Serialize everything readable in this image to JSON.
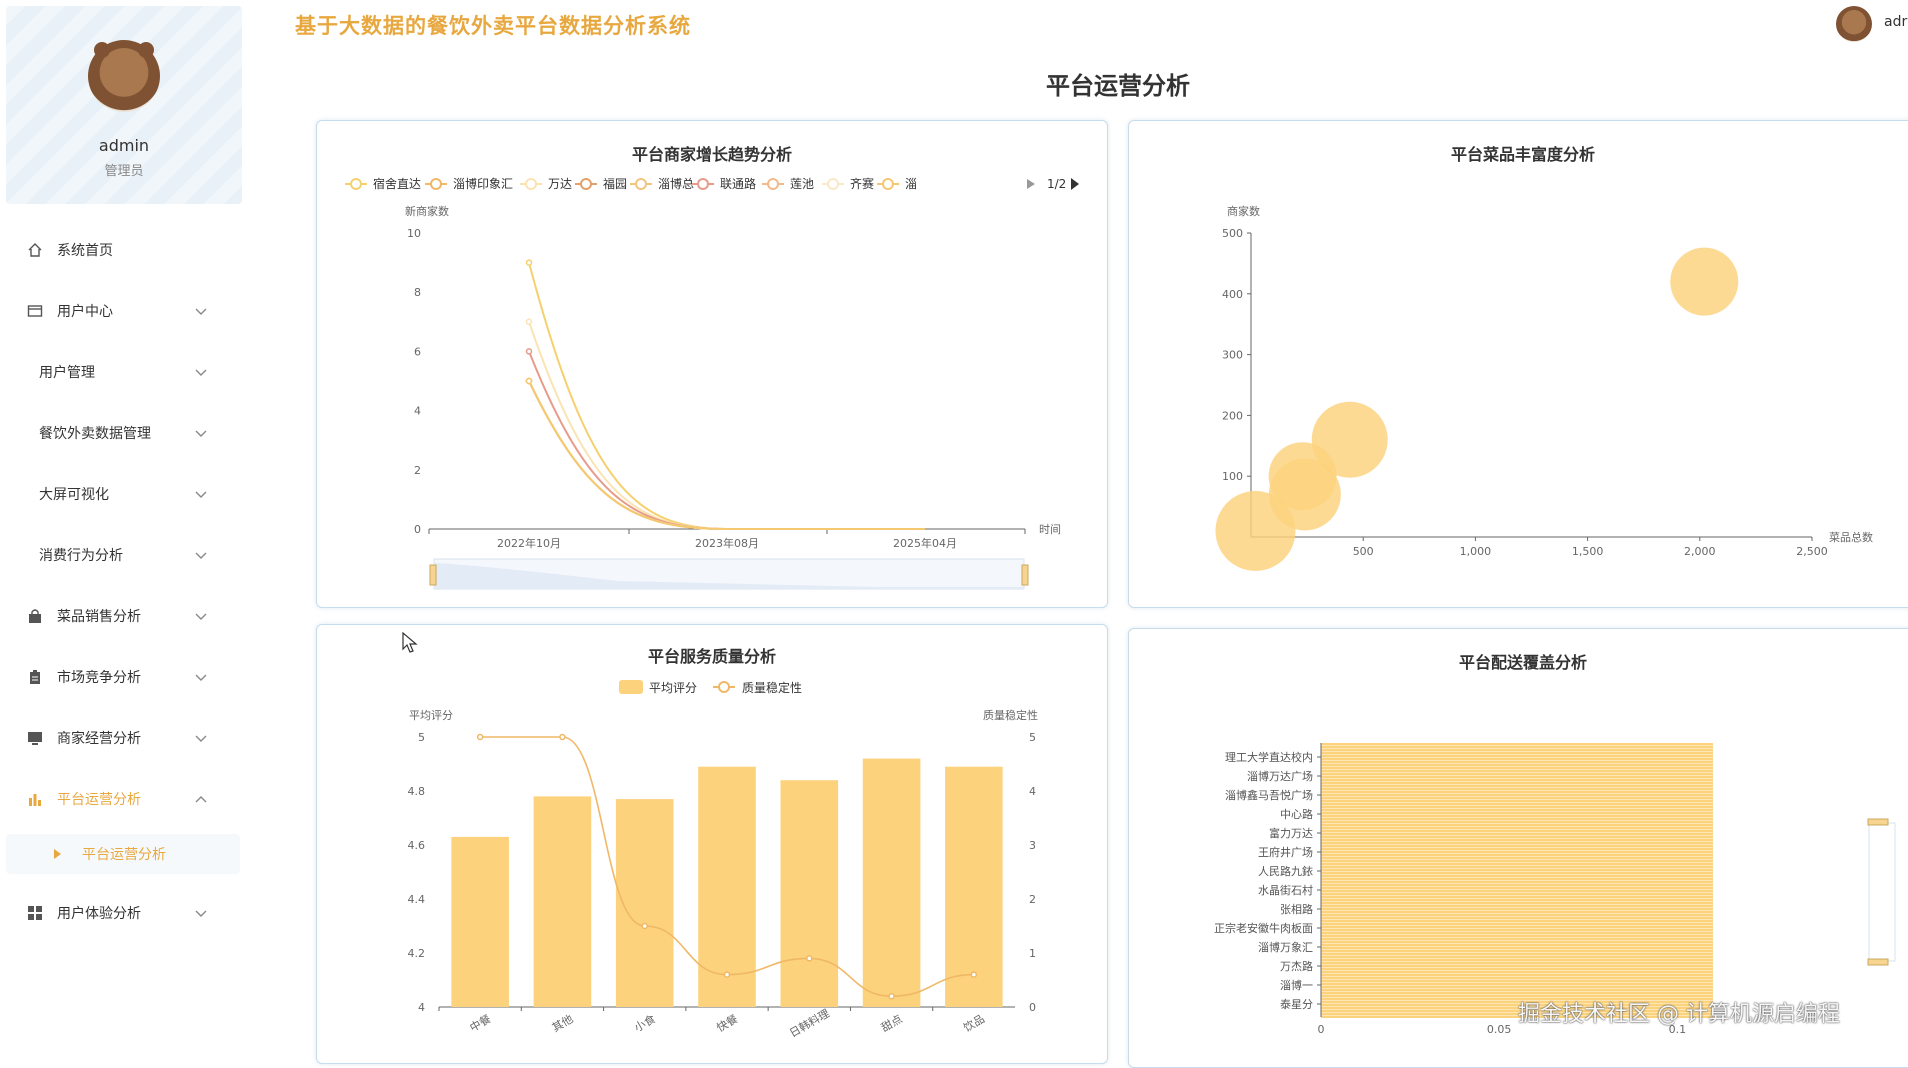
{
  "app": {
    "title": "基于大数据的餐饮外卖平台数据分析系统",
    "user": "adr"
  },
  "profile": {
    "name": "admin",
    "role": "管理员"
  },
  "menu": [
    {
      "label": "系统首页",
      "icon": "home-icon",
      "has_children": false,
      "active": false
    },
    {
      "label": "用户中心",
      "icon": "user-card-icon",
      "has_children": true,
      "active": false
    },
    {
      "label": "用户管理",
      "icon": "",
      "has_children": true,
      "active": false
    },
    {
      "label": "餐饮外卖数据管理",
      "icon": "",
      "has_children": true,
      "active": false
    },
    {
      "label": "大屏可视化",
      "icon": "",
      "has_children": true,
      "active": false
    },
    {
      "label": "消费行为分析",
      "icon": "",
      "has_children": true,
      "active": false
    },
    {
      "label": "菜品销售分析",
      "icon": "shopping-bag-icon",
      "has_children": true,
      "active": false
    },
    {
      "label": "市场竞争分析",
      "icon": "clipboard-icon",
      "has_children": true,
      "active": false
    },
    {
      "label": "商家经营分析",
      "icon": "monitor-icon",
      "has_children": true,
      "active": false
    },
    {
      "label": "平台运营分析",
      "icon": "bar-chart-icon",
      "has_children": true,
      "active": true,
      "expanded": true
    },
    {
      "label": "用户体验分析",
      "icon": "grid-icon",
      "has_children": true,
      "active": false
    }
  ],
  "submenu": {
    "label": "平台运营分析"
  },
  "page": {
    "title": "平台运营分析"
  },
  "watermark": "掘金技术社区 @ 计算机源启编程",
  "chart_data": [
    {
      "id": "merchant-growth",
      "type": "line",
      "title": "平台商家增长趋势分析",
      "ylabel": "新商家数",
      "xlabel": "时间",
      "ylim": [
        0,
        10
      ],
      "yticks": [
        0,
        2,
        4,
        6,
        8,
        10
      ],
      "categories": [
        "2022年10月",
        "2023年08月",
        "2025年04月"
      ],
      "legend_page": "1/2",
      "smooth": true,
      "series": [
        {
          "name": "宿舍直达",
          "values": [
            9,
            0,
            0
          ],
          "color": "#f5d06e"
        },
        {
          "name": "淄博印象汇",
          "values": [
            5,
            0,
            0
          ],
          "color": "#f0b866"
        },
        {
          "name": "万达",
          "values": [
            7,
            0,
            0
          ],
          "color": "#fbe3b2"
        },
        {
          "name": "福园",
          "values": [
            5,
            0,
            0
          ],
          "color": "#e3a06b"
        },
        {
          "name": "淄博总",
          "values": [
            5,
            0,
            0
          ],
          "color": "#f3c47d"
        },
        {
          "name": "联通路",
          "values": [
            6,
            0,
            0
          ],
          "color": "#e79b8a"
        },
        {
          "name": "莲池",
          "values": [
            5,
            0,
            0
          ],
          "color": "#f2b98d"
        },
        {
          "name": "齐赛",
          "values": [
            5,
            0,
            0
          ],
          "color": "#fae9c8"
        },
        {
          "name": "淄",
          "values": [
            5,
            0,
            0
          ],
          "color": "#f4c86e"
        }
      ]
    },
    {
      "id": "dish-richness",
      "type": "scatter",
      "title": "平台菜品丰富度分析",
      "xlabel": "菜品总数",
      "ylabel": "商家数",
      "xlim": [
        0,
        2500
      ],
      "ylim": [
        0,
        500
      ],
      "xticks": [
        500,
        1000,
        1500,
        2000,
        2500
      ],
      "xtick_labels": [
        "500",
        "1,000",
        "1,500",
        "2,000",
        "2,500"
      ],
      "yticks": [
        100,
        200,
        300,
        400,
        500
      ],
      "points": [
        {
          "x": 2020,
          "y": 420,
          "size": 34
        },
        {
          "x": 440,
          "y": 160,
          "size": 38
        },
        {
          "x": 230,
          "y": 100,
          "size": 34
        },
        {
          "x": 240,
          "y": 70,
          "size": 36
        },
        {
          "x": 20,
          "y": 10,
          "size": 40
        }
      ]
    },
    {
      "id": "service-quality",
      "type": "bar",
      "title": "平台服务质量分析",
      "categories": [
        "中餐",
        "其他",
        "小食",
        "快餐",
        "日韩料理",
        "甜点",
        "饮品"
      ],
      "ylabel": "平均评分",
      "y2label": "质量稳定性",
      "ylim": [
        4,
        5
      ],
      "yticks": [
        4,
        4.2,
        4.4,
        4.6,
        4.8,
        5
      ],
      "y2lim": [
        0,
        5
      ],
      "y2ticks": [
        0,
        1,
        2,
        3,
        4,
        5
      ],
      "series": [
        {
          "name": "平均评分",
          "type": "bar",
          "values": [
            4.63,
            4.78,
            4.77,
            4.89,
            4.84,
            4.92,
            4.89
          ],
          "color": "#fcd27c"
        },
        {
          "name": "质量稳定性",
          "type": "line",
          "values": [
            5,
            5,
            1.5,
            0.6,
            0.9,
            0.2,
            0.6
          ],
          "color": "#f0b866"
        }
      ]
    },
    {
      "id": "delivery-coverage",
      "type": "bar",
      "orientation": "horizontal",
      "title": "平台配送覆盖分析",
      "categories": [
        "理工大学直达校内",
        "淄博万达广场",
        "淄博鑫马吾悦广场",
        "中心路",
        "富力万达",
        "王府井广场",
        "人民路九銥",
        "水晶街石村",
        "张相路",
        "正宗老安徽牛肉板面",
        "淄博万象汇",
        "万杰路",
        "淄博一",
        "泰星分"
      ],
      "xticks": [
        0,
        0.05,
        0.1
      ],
      "xtick_labels": [
        "0",
        "0.05",
        "0.1"
      ],
      "color": "#fcd27c"
    }
  ]
}
